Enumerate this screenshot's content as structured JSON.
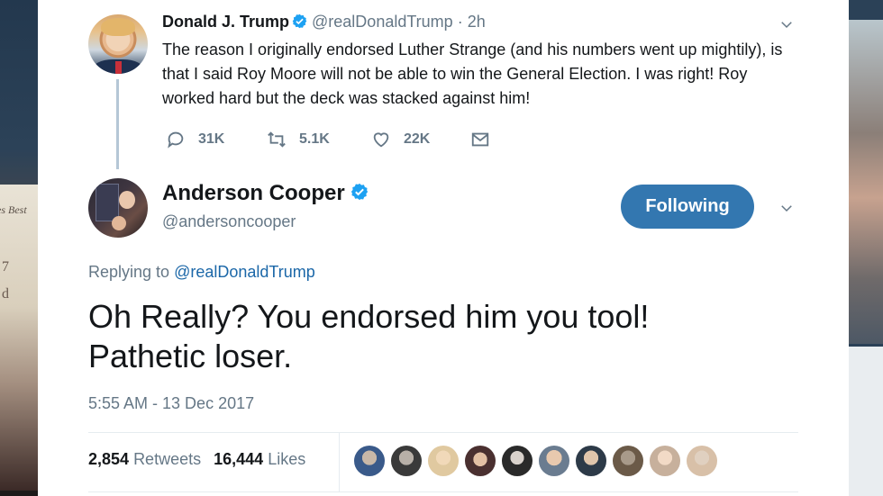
{
  "parent_tweet": {
    "name": "Donald J. Trump",
    "handle": "@realDonaldTrump",
    "time": "· 2h",
    "text": "The reason I originally endorsed Luther Strange (and his numbers went up mightily), is that I said Roy Moore will not be able to win the General Election.  I was right! Roy worked hard but the deck was stacked against him!",
    "replies": "31K",
    "retweets": "5.1K",
    "likes": "22K"
  },
  "main_tweet": {
    "name": "Anderson Cooper",
    "handle": "@andersoncooper",
    "follow_label": "Following",
    "replying_prefix": "Replying to",
    "replying_to": "@realDonaldTrump",
    "text": "Oh Really? You endorsed him you tool! Pathetic loser.",
    "timestamp": "5:55 AM - 13 Dec 2017",
    "retweet_count": "2,854",
    "retweet_label": "Retweets",
    "like_count": "16,444",
    "like_label": "Likes"
  },
  "background_text": {
    "book_fragment": "es Best",
    "letter_a": "7",
    "letter_b": "d"
  },
  "colors": {
    "accent": "#3377b0",
    "link": "#1b67a8",
    "muted": "#657786",
    "verified": "#1da1f2"
  },
  "icons": {
    "verified": "verified-badge-icon",
    "reply": "reply-icon",
    "retweet": "retweet-icon",
    "like": "heart-icon",
    "dm": "envelope-icon",
    "menu": "chevron-down-icon"
  },
  "liker_avatar_count": 10
}
